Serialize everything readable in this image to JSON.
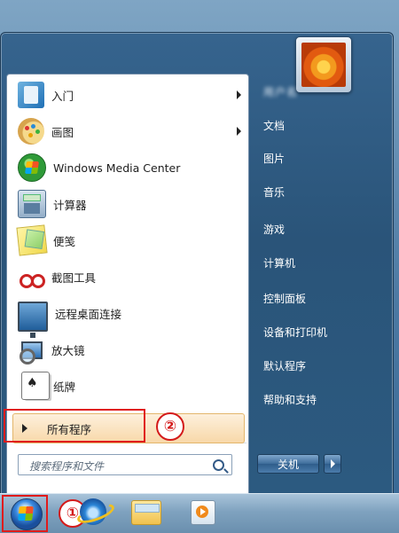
{
  "start_menu": {
    "programs": [
      {
        "label": "入门",
        "icon": "getting-started-icon",
        "has_submenu": true
      },
      {
        "label": "画图",
        "icon": "paint-icon",
        "has_submenu": true
      },
      {
        "label": "Windows Media Center",
        "icon": "windows-media-center-icon",
        "has_submenu": false
      },
      {
        "label": "计算器",
        "icon": "calculator-icon",
        "has_submenu": false
      },
      {
        "label": "便笺",
        "icon": "sticky-notes-icon",
        "has_submenu": false
      },
      {
        "label": "截图工具",
        "icon": "snipping-tool-icon",
        "has_submenu": false
      },
      {
        "label": "远程桌面连接",
        "icon": "remote-desktop-icon",
        "has_submenu": false
      },
      {
        "label": "放大镜",
        "icon": "magnifier-icon",
        "has_submenu": false
      },
      {
        "label": "纸牌",
        "icon": "solitaire-icon",
        "has_submenu": false
      }
    ],
    "all_programs_label": "所有程序",
    "search_placeholder": "搜索程序和文件",
    "user_name": "用户名",
    "right_items": [
      "文档",
      "图片",
      "音乐",
      "游戏",
      "计算机",
      "控制面板",
      "设备和打印机",
      "默认程序",
      "帮助和支持"
    ],
    "shutdown_label": "关机"
  },
  "annotations": {
    "marker_1": "①",
    "marker_2": "②",
    "highlight_color": "#e01b1b"
  },
  "taskbar": {
    "items": [
      "start-orb",
      "internet-explorer-icon",
      "windows-explorer-icon",
      "media-player-icon"
    ]
  }
}
